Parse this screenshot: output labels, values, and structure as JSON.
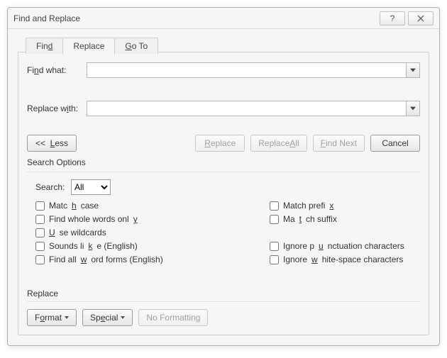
{
  "title": "Find and Replace",
  "tabs": {
    "find": "Find",
    "replace": "Replace",
    "goto": "Go To",
    "find_u": "d",
    "goto_u": "G"
  },
  "labels": {
    "find_what": "Find what:",
    "replace_with": "Replace with:",
    "replace_with_u": "i",
    "search_options": "Search Options",
    "search": "Search:",
    "replace_section": "Replace"
  },
  "inputs": {
    "find_what_value": "",
    "replace_with_value": "",
    "search_select": "All"
  },
  "buttons": {
    "less": "<<  Less",
    "less_u": "L",
    "replace": "Replace",
    "replace_u": "R",
    "replace_all": "Replace All",
    "replace_all_u": "A",
    "find_next": "Find Next",
    "find_next_u": "F",
    "cancel": "Cancel",
    "format": "Format",
    "format_u": "o",
    "special": "Special",
    "special_u": "e",
    "no_formatting": "No Formatting"
  },
  "options": {
    "match_case": "Match case",
    "whole_words": "Find whole words only",
    "wildcards": "Use wildcards",
    "sounds_like": "Sounds like (English)",
    "word_forms": "Find all word forms (English)",
    "match_prefix": "Match prefix",
    "match_suffix": "Match suffix",
    "ignore_punct": "Ignore punctuation characters",
    "ignore_ws": "Ignore white-space characters"
  }
}
